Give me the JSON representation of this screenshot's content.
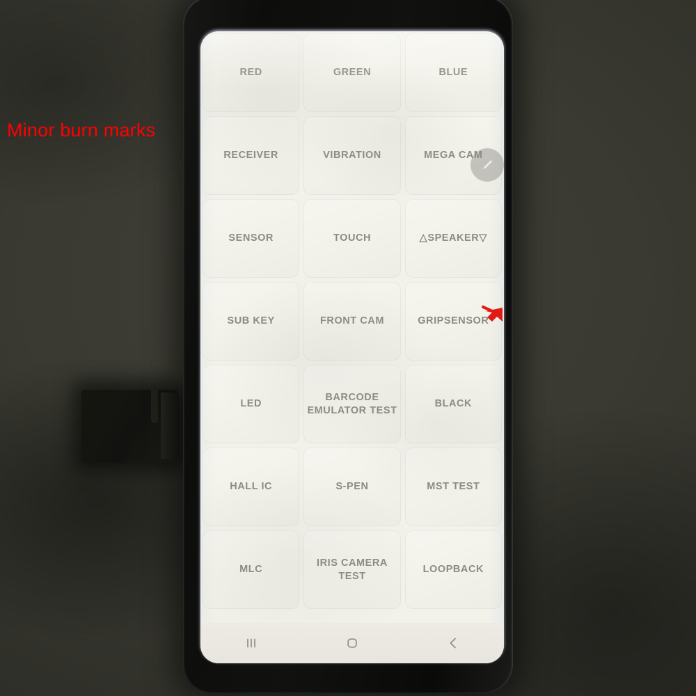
{
  "annotation": {
    "text": "Minor burn marks",
    "color": "#ff0000",
    "arrow_color": "#e01b16",
    "arrow_name": "cursor-arrow"
  },
  "scene": {
    "background_color": "#3a3a32",
    "phone_frame_color": "#111110",
    "clamp_color": "#141410"
  },
  "device": {
    "screen_background": "#f2f1ea",
    "button_face_color": "#f4f3ec",
    "label_color": "#8b8b84"
  },
  "fab": {
    "icon": "pen-icon",
    "color": "#8a8a86"
  },
  "grid": {
    "columns": 3,
    "rows": 7,
    "buttons": [
      {
        "label": "RED",
        "name": "test-button-red"
      },
      {
        "label": "GREEN",
        "name": "test-button-green"
      },
      {
        "label": "BLUE",
        "name": "test-button-blue"
      },
      {
        "label": "RECEIVER",
        "name": "test-button-receiver"
      },
      {
        "label": "VIBRATION",
        "name": "test-button-vibration"
      },
      {
        "label": "MEGA CAM",
        "name": "test-button-mega-cam"
      },
      {
        "label": "SENSOR",
        "name": "test-button-sensor"
      },
      {
        "label": "TOUCH",
        "name": "test-button-touch"
      },
      {
        "label": "△SPEAKER▽",
        "name": "test-button-speaker"
      },
      {
        "label": "SUB KEY",
        "name": "test-button-sub-key"
      },
      {
        "label": "FRONT CAM",
        "name": "test-button-front-cam"
      },
      {
        "label": "GRIPSENSOR",
        "name": "test-button-gripsensor"
      },
      {
        "label": "LED",
        "name": "test-button-led"
      },
      {
        "label": "BARCODE\nEMULATOR TEST",
        "name": "test-button-barcode-emulator-test"
      },
      {
        "label": "BLACK",
        "name": "test-button-black"
      },
      {
        "label": "HALL IC",
        "name": "test-button-hall-ic"
      },
      {
        "label": "S-PEN",
        "name": "test-button-s-pen"
      },
      {
        "label": "MST TEST",
        "name": "test-button-mst-test"
      },
      {
        "label": "MLC",
        "name": "test-button-mlc"
      },
      {
        "label": "IRIS CAMERA TEST",
        "name": "test-button-iris-camera-test"
      },
      {
        "label": "LOOPBACK",
        "name": "test-button-loopback"
      }
    ]
  },
  "navbar": {
    "items": [
      {
        "name": "nav-recents-button",
        "icon": "recents-icon"
      },
      {
        "name": "nav-home-button",
        "icon": "home-icon"
      },
      {
        "name": "nav-back-button",
        "icon": "back-icon"
      }
    ],
    "icon_color": "#8e8e88"
  }
}
